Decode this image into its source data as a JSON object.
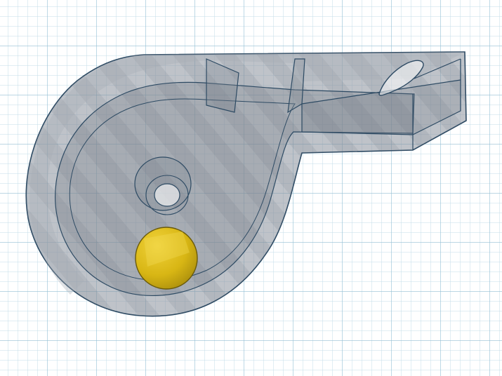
{
  "app": {
    "view": "3d-workplane",
    "workplane": {
      "background_color": "#ffffff",
      "minor_grid_color": "#c3dce8",
      "major_grid_color": "#93bfd4"
    },
    "model": {
      "object_name": "whistle",
      "material": "transparent",
      "body_fill_color": "#8a929c",
      "edge_color": "#2d4a63",
      "stripe_color": "#6f7882"
    },
    "ball": {
      "fill_color": "#d8b614",
      "highlight_color": "#f0d23a",
      "edge_color": "#6a5a0a"
    }
  }
}
